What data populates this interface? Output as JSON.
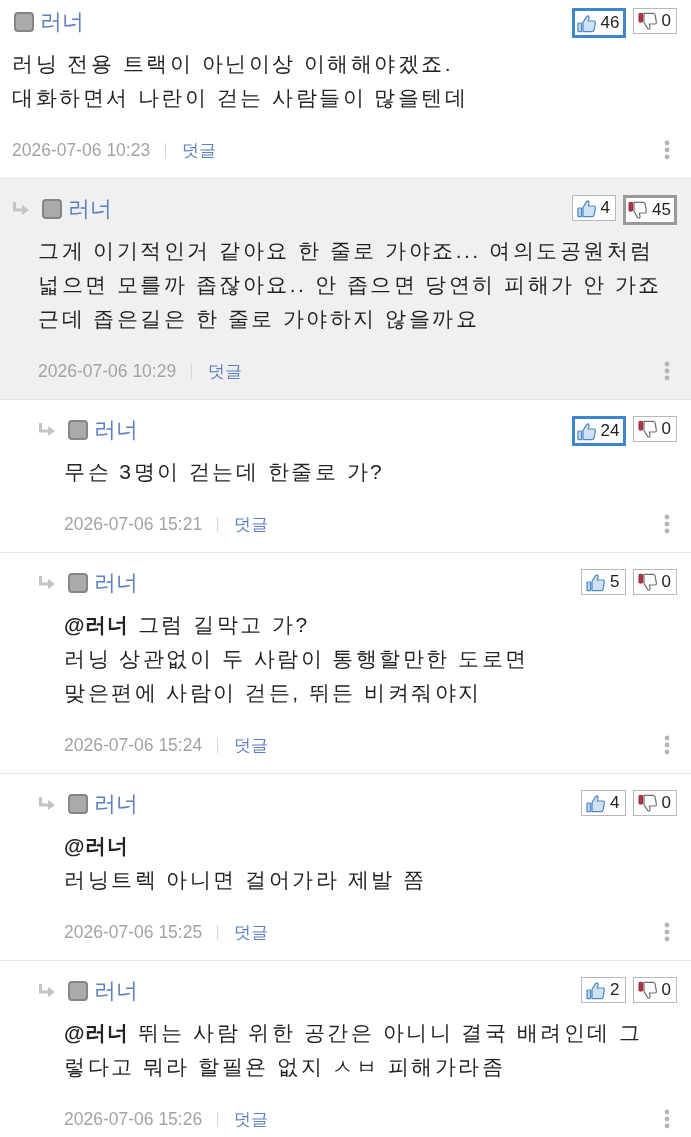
{
  "comments": [
    {
      "author": "러너",
      "highlighted": false,
      "likes": {
        "count": "46",
        "highlighted": true
      },
      "dislikes": {
        "count": "0",
        "highlighted": false
      },
      "lines": [
        "러닝 전용 트랙이 아닌이상 이해해야겠죠.",
        "대화하면서 나란이 걷는 사람들이 많을텐데"
      ],
      "date": "2026-07-06 10:23",
      "reply_label": "덧글",
      "children": [
        {
          "author": "러너",
          "highlighted": true,
          "likes": {
            "count": "4",
            "highlighted": false
          },
          "dislikes": {
            "count": "45",
            "highlighted": true
          },
          "lines": [
            "그게 이기적인거 같아요 한 줄로 가야죠... 여의도공원처럼",
            "넓으면 모를까 좁잖아요.. 안 좁으면 당연히 피해가 안 가죠",
            "근데 좁은길은 한 줄로 가야하지 않을까요"
          ],
          "date": "2026-07-06 10:29",
          "reply_label": "덧글",
          "children": [
            {
              "author": "러너",
              "highlighted": false,
              "likes": {
                "count": "24",
                "highlighted": true
              },
              "dislikes": {
                "count": "0",
                "highlighted": false
              },
              "lines": [
                "무슨 3명이 걷는데 한줄로 가?"
              ],
              "date": "2026-07-06 15:21",
              "reply_label": "덧글"
            },
            {
              "author": "러너",
              "highlighted": false,
              "likes": {
                "count": "5",
                "highlighted": false
              },
              "dislikes": {
                "count": "0",
                "highlighted": false
              },
              "lines": [
                "**@러너** 그럼 길막고 가?",
                "러닝 상관없이 두 사람이 통행할만한 도로면",
                "맞은편에 사람이 걷든, 뛰든 비켜줘야지"
              ],
              "date": "2026-07-06 15:24",
              "reply_label": "덧글"
            },
            {
              "author": "러너",
              "highlighted": false,
              "likes": {
                "count": "4",
                "highlighted": false
              },
              "dislikes": {
                "count": "0",
                "highlighted": false
              },
              "lines": [
                "**@러너**",
                "러닝트렉 아니면 걸어가라 제발 쫌"
              ],
              "date": "2026-07-06 15:25",
              "reply_label": "덧글"
            },
            {
              "author": "러너",
              "highlighted": false,
              "likes": {
                "count": "2",
                "highlighted": false
              },
              "dislikes": {
                "count": "0",
                "highlighted": false
              },
              "lines": [
                "**@러너** 뛰는 사람 위한 공간은 아니니 결국 배려인데 그",
                "렇다고 뭐라 할필욘 없지 ㅅㅂ 피해가라좀"
              ],
              "date": "2026-07-06 15:26",
              "reply_label": "덧글"
            }
          ]
        }
      ]
    }
  ]
}
